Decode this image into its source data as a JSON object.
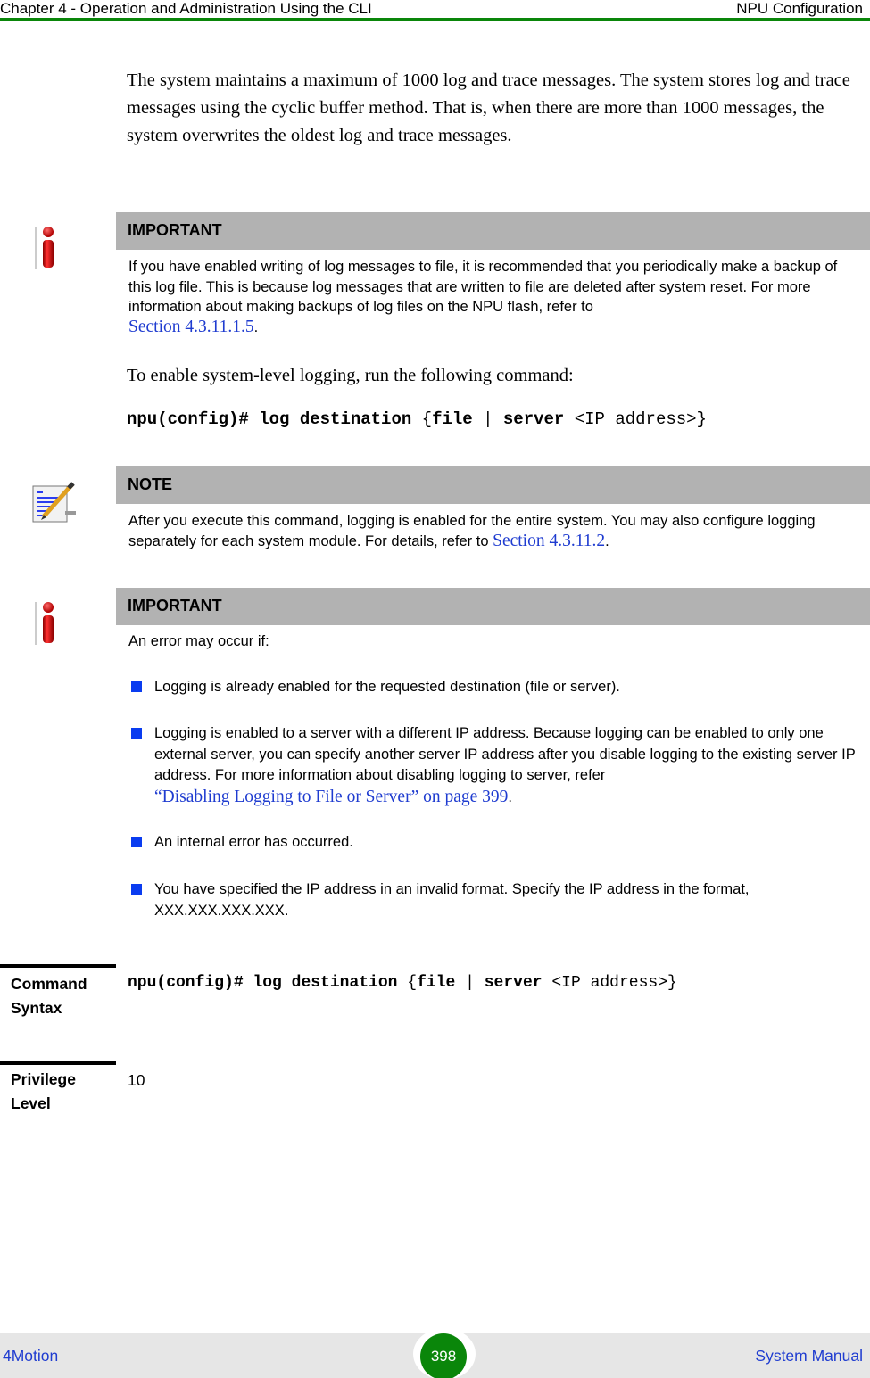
{
  "header": {
    "chapter": "Chapter 4 - Operation and Administration Using the CLI",
    "section": "NPU Configuration",
    "accent_color": "#0a860a"
  },
  "intro_paragraph": "The system maintains a maximum of 1000 log and trace messages. The system stores log and trace messages using the cyclic buffer method. That is, when there are more than 1000 messages, the system overwrites the oldest log and trace messages.",
  "important_1": {
    "icon": "info-icon",
    "title": "IMPORTANT",
    "text": "If you have enabled writing of log messages to file, it is recommended that you periodically make a backup of this log file. This is because log messages that are written to file are deleted after system reset. For more information about making backups of log files on the NPU flash, refer to",
    "link": "Section 4.3.11.1.5",
    "suffix": "."
  },
  "enable_paragraph": "To enable system-level logging, run the following command:",
  "command": {
    "prompt": "npu(config)#",
    "keyword": "log destination",
    "open": "{",
    "opt1": "file",
    "sep": "|",
    "opt2": "server",
    "arg": "<IP address>",
    "close": "}"
  },
  "note": {
    "icon": "note-pencil-icon",
    "title": "NOTE",
    "text": "After you execute this command, logging is enabled for the entire system. You may also configure logging separately for each system module. For details, refer to",
    "link": "Section 4.3.11.2",
    "suffix": "."
  },
  "important_2": {
    "icon": "info-icon",
    "title": "IMPORTANT",
    "intro": "An error may occur if:",
    "bullets": [
      {
        "text": "Logging is already enabled for the requested destination (file or server)."
      },
      {
        "text": "Logging is enabled to a server with a different IP address. Because logging can be enabled to only one external server, you can specify another server IP address after you disable logging to the existing server IP address. For more information about disabling logging to server, refer",
        "link": "“Disabling Logging to File or Server” on page 399",
        "suffix": "."
      },
      {
        "text": "An internal error has occurred."
      },
      {
        "text": "You have specified the IP address in an invalid format. Specify the IP address in the format, XXX.XXX.XXX.XXX."
      }
    ],
    "bullet_color": "#0a3cf0"
  },
  "table": {
    "syntax_label": "Command Syntax",
    "privilege_label": "Privilege Level",
    "privilege_value": "10"
  },
  "footer": {
    "product": "4Motion",
    "page_number": "398",
    "manual": "System Manual",
    "link_color": "#1f3cd0"
  }
}
